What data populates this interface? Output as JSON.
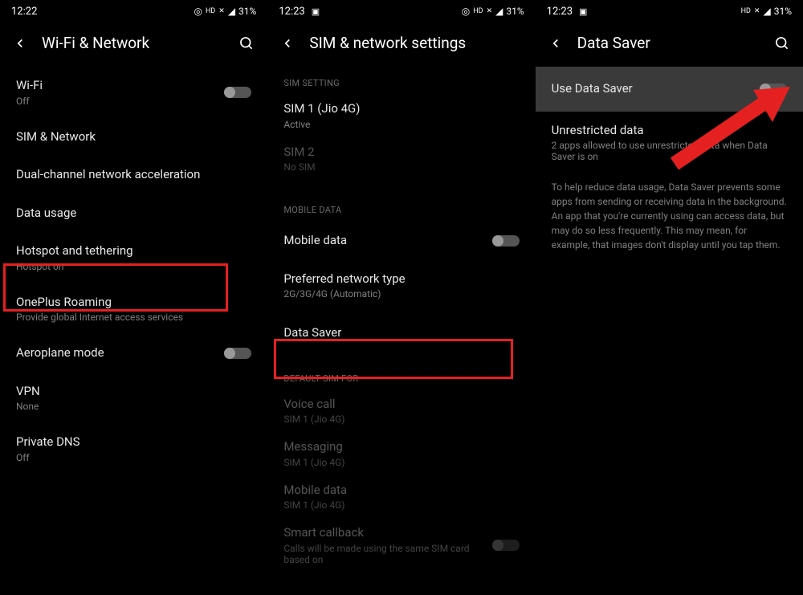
{
  "screen1": {
    "time": "12:22",
    "battery": "31%",
    "title": "Wi-Fi & Network",
    "items": [
      {
        "title": "Wi-Fi",
        "sub": "Off",
        "toggle": true,
        "toggleOn": false
      },
      {
        "title": "SIM & Network",
        "sub": ""
      },
      {
        "title": "Dual-channel network acceleration",
        "sub": ""
      },
      {
        "title": "Data usage",
        "sub": ""
      },
      {
        "title": "Hotspot and tethering",
        "sub": "Hotspot on"
      },
      {
        "title": "OnePlus Roaming",
        "sub": "Provide global Internet access services"
      },
      {
        "title": "Aeroplane mode",
        "sub": "",
        "toggle": true,
        "toggleOn": false
      },
      {
        "title": "VPN",
        "sub": "None"
      },
      {
        "title": "Private DNS",
        "sub": "Off"
      }
    ]
  },
  "screen2": {
    "time": "12:23",
    "battery": "31%",
    "title": "SIM & network settings",
    "sections": {
      "sim_setting": "SIM SETTING",
      "mobile_data": "MOBILE DATA",
      "default_sim": "DEFAULT SIM FOR"
    },
    "items": {
      "sim1": {
        "title": "SIM 1 (Jio 4G)",
        "sub": "Active"
      },
      "sim2": {
        "title": "SIM 2",
        "sub": "No SIM"
      },
      "mobile_data": {
        "title": "Mobile data"
      },
      "preferred": {
        "title": "Preferred network type",
        "sub": "2G/3G/4G (Automatic)"
      },
      "datasaver": {
        "title": "Data Saver"
      },
      "voice": {
        "title": "Voice call",
        "sub": "SIM 1 (Jio 4G)"
      },
      "messaging": {
        "title": "Messaging",
        "sub": "SIM 1 (Jio 4G)"
      },
      "mobile_data2": {
        "title": "Mobile data",
        "sub": "SIM 1 (Jio 4G)"
      },
      "callback": {
        "title": "Smart callback",
        "sub": "Calls will be made using the same SIM card based on"
      }
    }
  },
  "screen3": {
    "time": "12:23",
    "battery": "31%",
    "title": "Data Saver",
    "use_datasaver": "Use Data Saver",
    "unrestricted": {
      "title": "Unrestricted data",
      "sub": "2 apps allowed to use unrestricted data when Data Saver is on"
    },
    "description": "To help reduce data usage, Data Saver prevents some apps from sending or receiving data in the background. An app that you're currently using can access data, but may do so less frequently. This may mean, for example, that images don't display until you tap them."
  }
}
